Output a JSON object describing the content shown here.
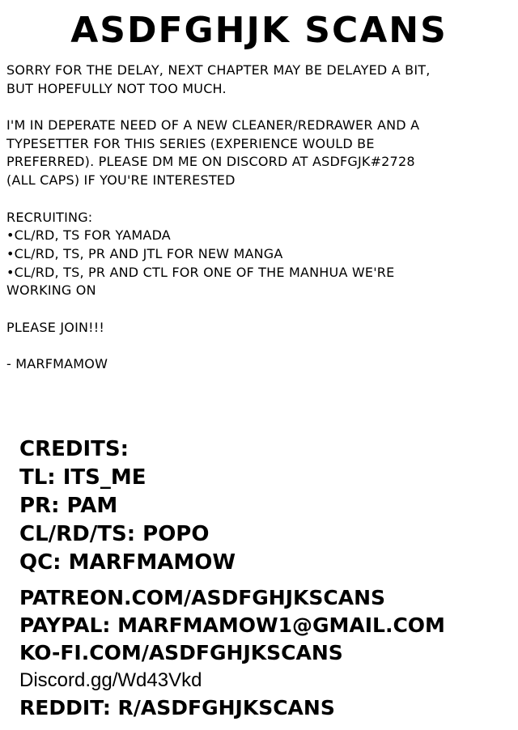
{
  "title": "ASDFGHJK SCANS",
  "notice": {
    "p1": [
      "SORRY FOR THE DELAY, NEXT CHAPTER MAY BE DELAYED A BIT,",
      "BUT HOPEFULLY NOT TOO MUCH."
    ],
    "p2": [
      "I'M IN DEPERATE NEED OF A NEW CLEANER/REDRAWER AND A",
      "TYPESETTER FOR THIS SERIES (EXPERIENCE WOULD BE",
      "PREFERRED). PLEASE DM ME ON DISCORD AT ASDFGJK#2728",
      "(ALL CAPS) IF YOU'RE INTERESTED"
    ],
    "p3": [
      "RECRUITING:",
      "•CL/RD, TS FOR YAMADA",
      "•CL/RD, TS, PR AND JTL FOR NEW MANGA",
      "•CL/RD, TS, PR AND CTL FOR ONE OF THE MANHUA WE'RE",
      "WORKING ON"
    ],
    "p4": "PLEASE JOIN!!!",
    "signature": "- MARFMAMOW"
  },
  "credits": {
    "heading": "CREDITS:",
    "tl": "TL: ITS_ME",
    "pr": "PR: PAM",
    "clrdts": "CL/RD/TS: POPO",
    "qc": "QC: MARFMAMOW"
  },
  "links": {
    "patreon": "PATREON.COM/ASDFGHJKSCANS",
    "paypal": "PAYPAL: MARFMAMOW1@GMAIL.COM",
    "kofi": "KO-FI.COM/ASDFGHJKSCANS",
    "discord": "Discord.gg/Wd43Vkd",
    "reddit": "REDDIT: R/ASDFGHJKSCANS"
  }
}
